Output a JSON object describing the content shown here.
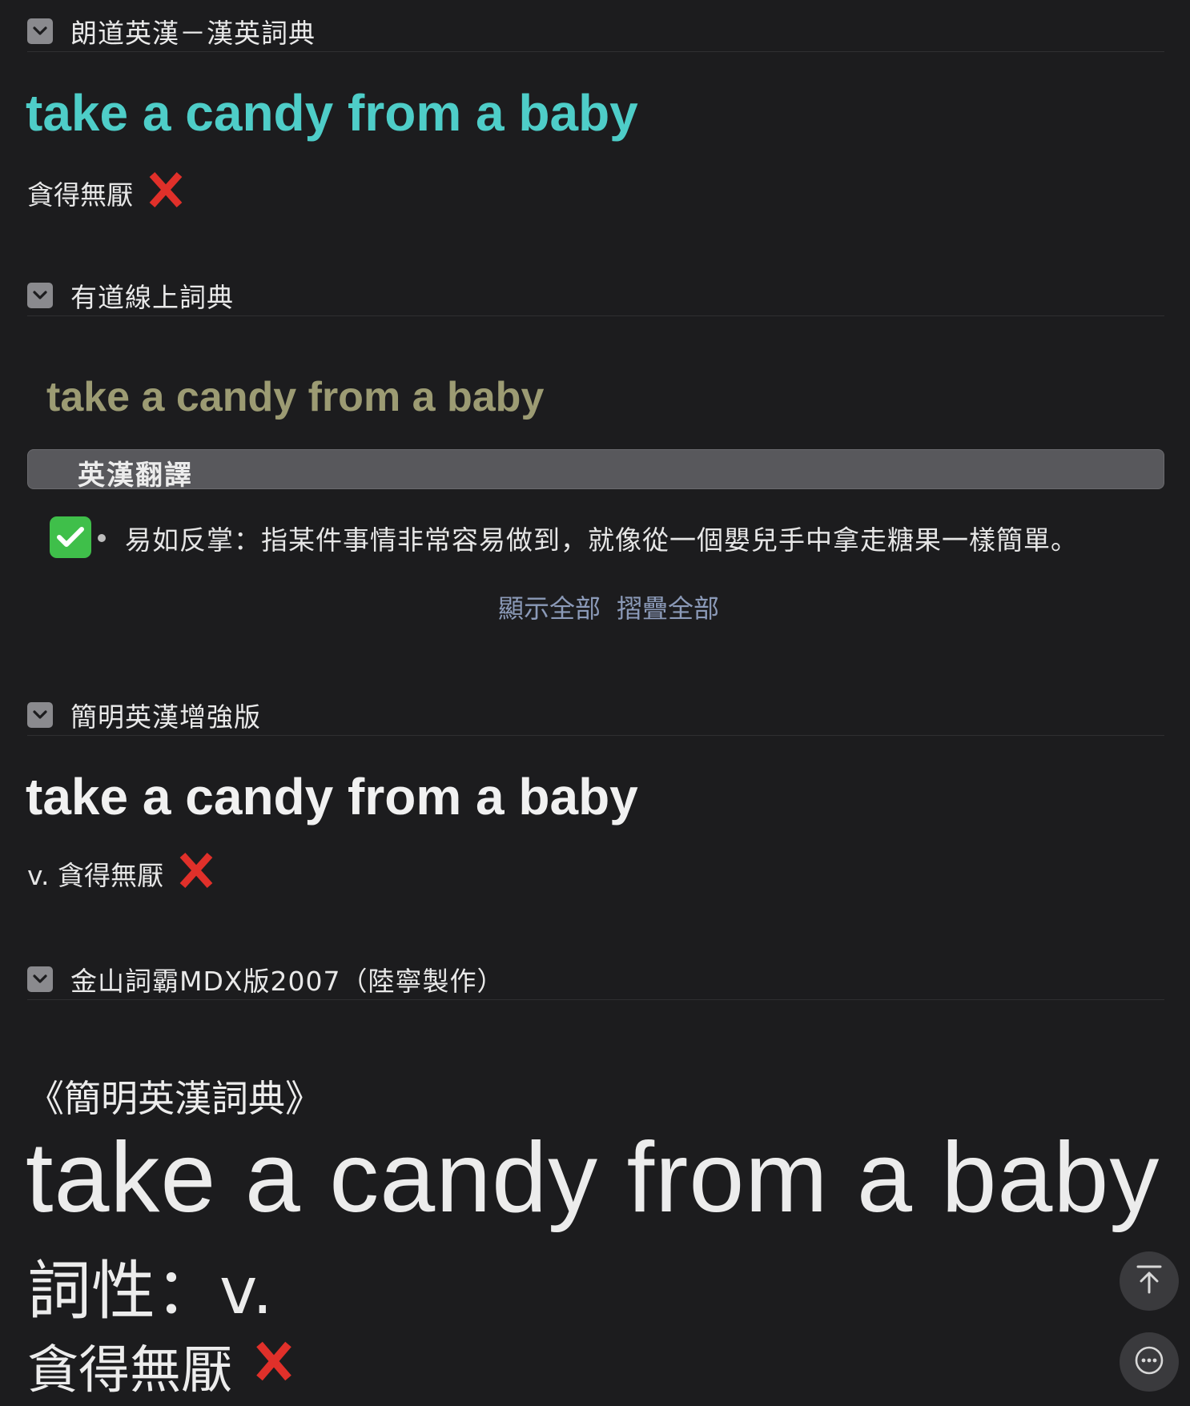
{
  "sections": [
    {
      "title": "朗道英漢－漢英詞典",
      "headword": "take a candy from a baby",
      "definition": "貪得無厭"
    },
    {
      "title": "有道線上詞典",
      "headword": "take a candy from a baby",
      "translation_label": "英漢翻譯",
      "translation": "易如反掌：指某件事情非常容易做到，就像從一個嬰兒手中拿走糖果一樣簡單。",
      "show_all": "顯示全部",
      "collapse_all": "摺疊全部"
    },
    {
      "title": "簡明英漢增強版",
      "headword": "take a candy from a baby",
      "definition": "v. 貪得無厭"
    },
    {
      "title": "金山詞霸MDX版2007（陸寧製作）",
      "book": "《簡明英漢詞典》",
      "headword": "take a candy from a baby",
      "pos": "詞性：v.",
      "definition": "貪得無厭"
    }
  ],
  "icons": {
    "toggle": "chevron-down-icon",
    "wrong": "red-cross-mark-icon",
    "right": "green-check-mark-icon",
    "scroll_top": "arrow-up-to-top-icon",
    "more": "more-dots-icon"
  },
  "colors": {
    "background": "#1c1c1e",
    "headword_cyan": "#4ecdc8",
    "headword_olive": "#9c9b73",
    "link": "#8b9ab8",
    "cross_red": "#e0302a",
    "check_green": "#3fbf4a"
  }
}
